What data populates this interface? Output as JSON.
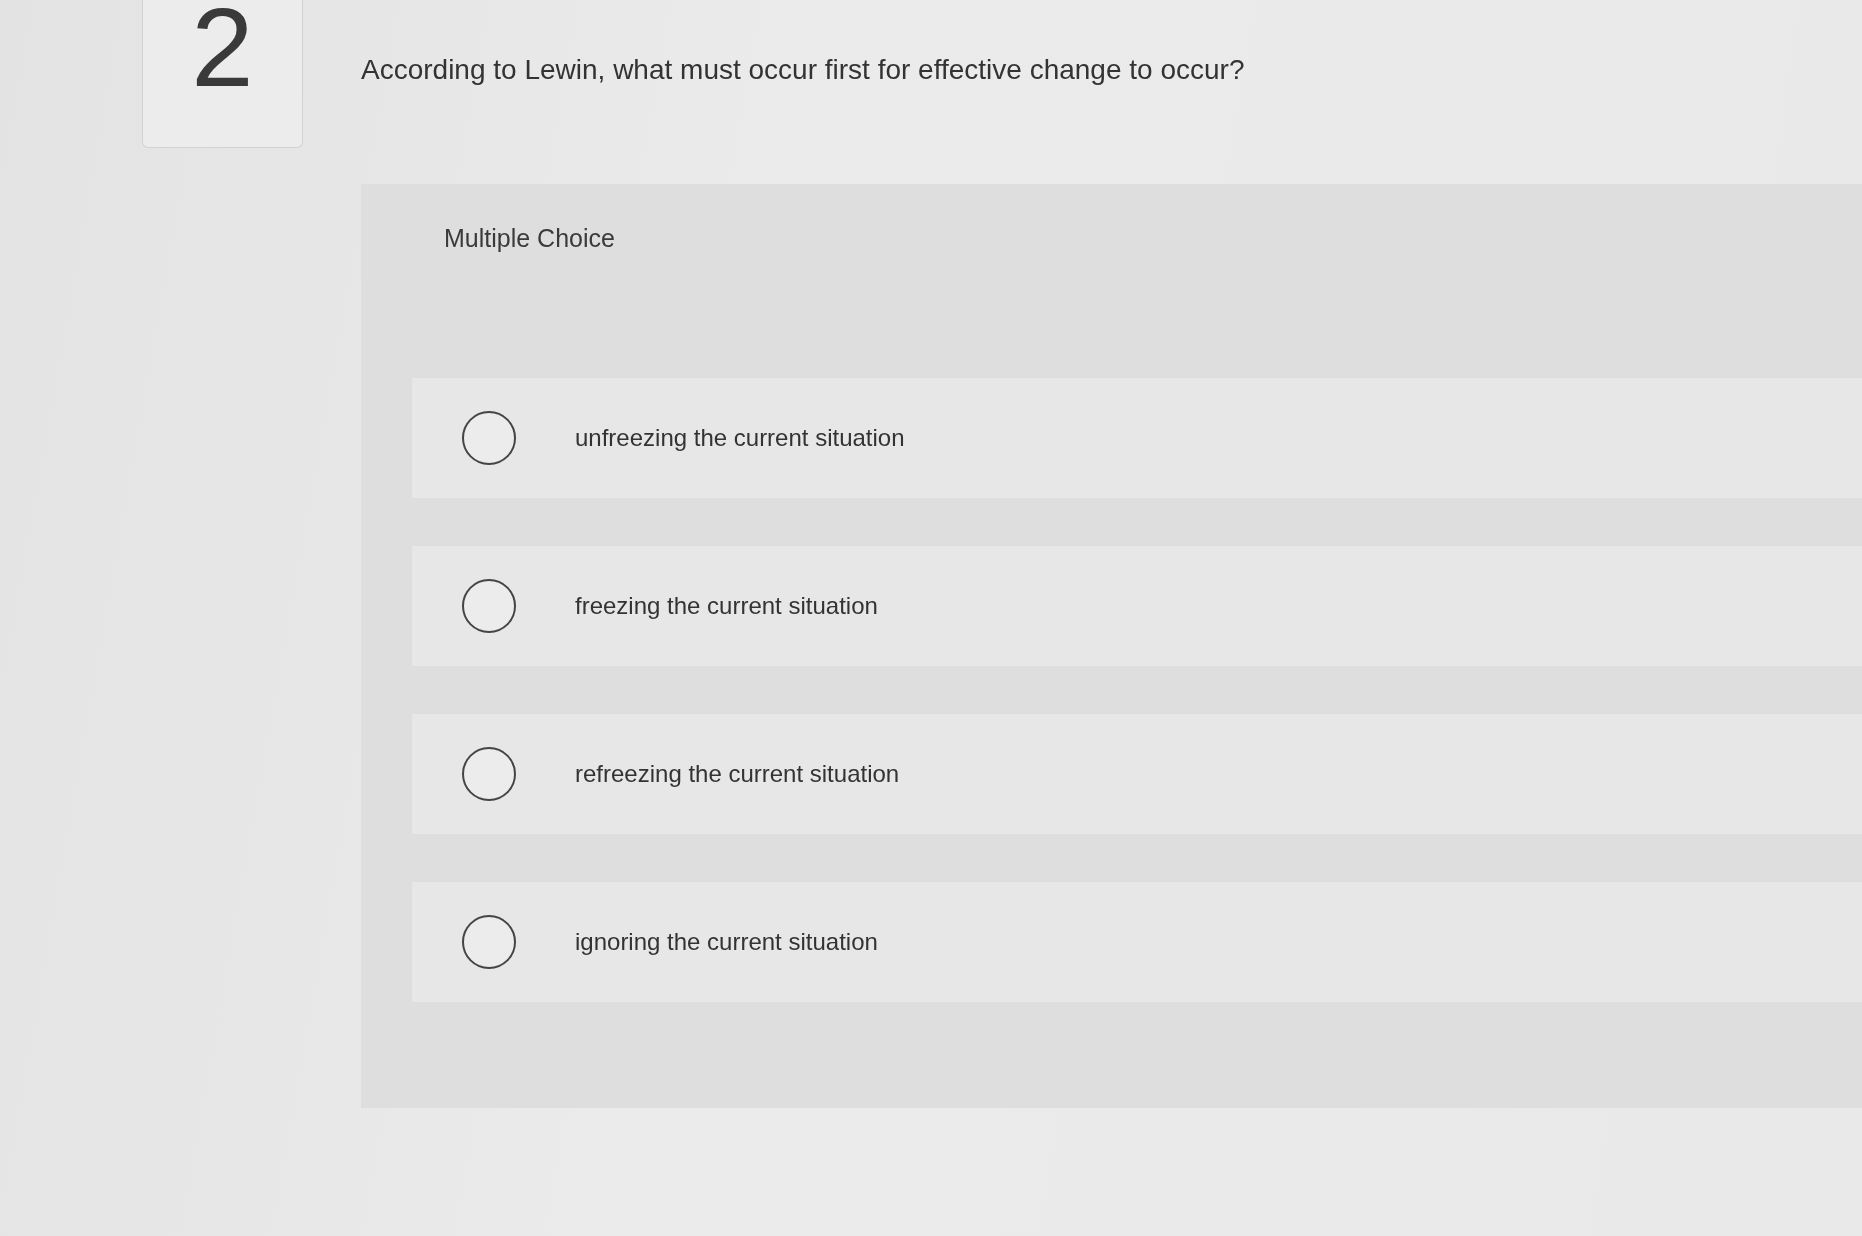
{
  "question": {
    "number": "2",
    "text": "According to Lewin, what must occur first for effective change to occur?"
  },
  "answer_panel": {
    "title": "Multiple Choice",
    "options": [
      {
        "label": "unfreezing the current situation",
        "selected": false
      },
      {
        "label": "freezing the current situation",
        "selected": false
      },
      {
        "label": "refreezing the current situation",
        "selected": false
      },
      {
        "label": "ignoring the current situation",
        "selected": false
      }
    ]
  }
}
